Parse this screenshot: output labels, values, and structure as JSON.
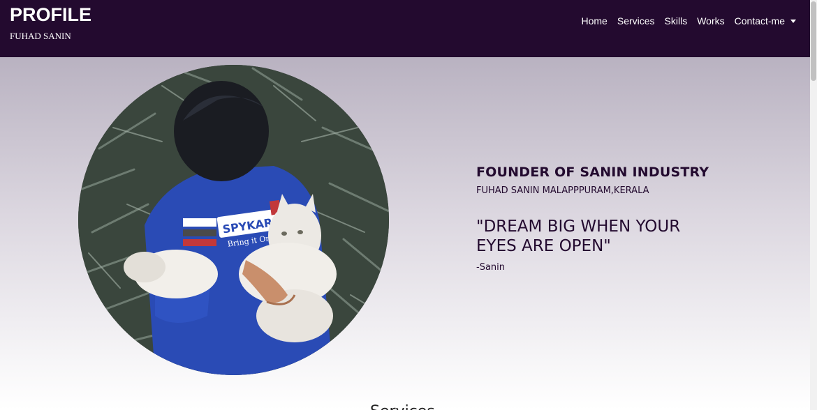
{
  "navbar": {
    "brand_title": "PROFILE",
    "brand_subtitle": "FUHAD SANIN",
    "links": [
      "Home",
      "Services",
      "Skills",
      "Works",
      "Contact-me"
    ]
  },
  "hero": {
    "heading": "FOUNDER OF SANIN INDUSTRY",
    "subheading": "FUHAD SANIN MALAPPPURAM,KERALA",
    "quote": "\"DREAM BIG WHEN YOUR EYES ARE OPEN\"",
    "quote_author": "-Sanin",
    "photo_text": {
      "brand": "SPYKAR",
      "tagline": "Bring it On"
    }
  },
  "next_section": {
    "title_peek": "Services"
  },
  "icons": {
    "dropdown": "caret-down-icon"
  },
  "colors": {
    "navbar_bg": "#230a2f",
    "text_dark": "#230a2f",
    "hero_gradient_top": "#b9b2c1",
    "hero_gradient_bottom": "#ffffff"
  }
}
